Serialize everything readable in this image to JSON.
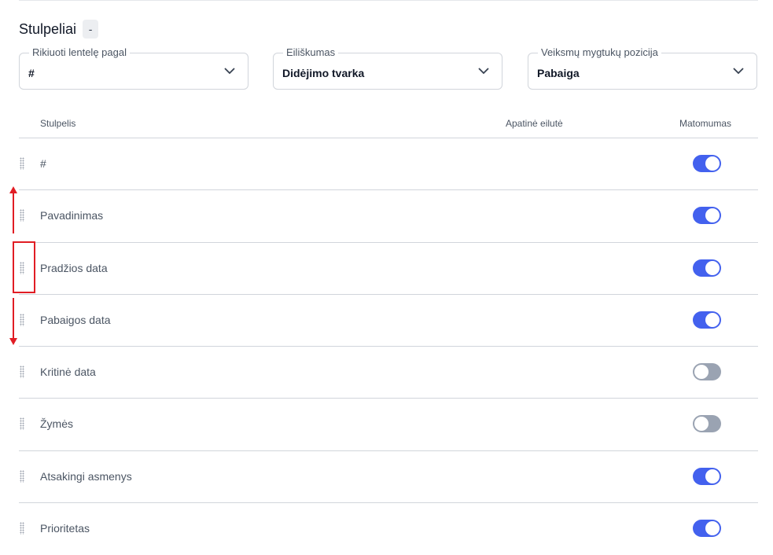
{
  "section": {
    "title": "Stulpeliai",
    "collapse_label": "-"
  },
  "filters": {
    "sort_by": {
      "label": "Rikiuoti lentelę pagal",
      "value": "#"
    },
    "order": {
      "label": "Eiliškumas",
      "value": "Didėjimo tvarka"
    },
    "actions_position": {
      "label": "Veiksmų mygtukų pozicija",
      "value": "Pabaiga"
    }
  },
  "table": {
    "headers": {
      "column": "Stulpelis",
      "bottom_row": "Apatinė eilutė",
      "visibility": "Matomumas"
    },
    "rows": [
      {
        "name": "#",
        "visible": true
      },
      {
        "name": "Pavadinimas",
        "visible": true
      },
      {
        "name": "Pradžios data",
        "visible": true
      },
      {
        "name": "Pabaigos data",
        "visible": true
      },
      {
        "name": "Kritinė data",
        "visible": false
      },
      {
        "name": "Žymės",
        "visible": false
      },
      {
        "name": "Atsakingi asmenys",
        "visible": true
      },
      {
        "name": "Prioritetas",
        "visible": true
      }
    ]
  },
  "colors": {
    "toggle_on": "#4361ee",
    "toggle_off": "#9aa3b2",
    "annotation": "#e11d24"
  },
  "icons": {
    "dropdown": "chevron-down-icon",
    "drag": "drag-handle-icon",
    "annotation_up": "arrow-up-icon",
    "annotation_down": "arrow-down-icon"
  }
}
